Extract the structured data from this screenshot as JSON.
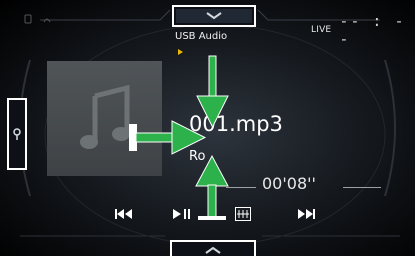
{
  "status_bar": {
    "live_label": "LIVE",
    "clock": "-- : --"
  },
  "source": {
    "label": "USB Audio"
  },
  "track": {
    "file_name": "001.mp3",
    "artist": "Ro",
    "elapsed": "00'08''"
  },
  "icons": {
    "top_tab": "chevron-down-icon",
    "bottom_tab": "chevron-up-icon",
    "left_tab": "search-icon",
    "prev": "previous-track-icon",
    "play_pause": "play-pause-icon",
    "mode": "music-mode-icon",
    "next": "next-track-icon",
    "album": "music-note-icon"
  },
  "colors": {
    "accent_arrow": "#2db24b",
    "play_indicator": "#f0b800",
    "tab_outline": "#ffffff"
  }
}
